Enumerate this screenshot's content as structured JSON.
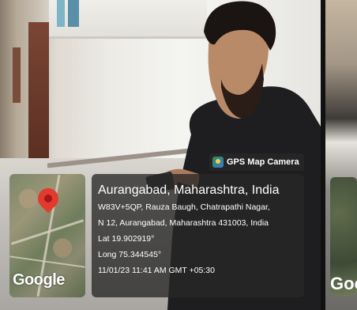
{
  "overlay": {
    "app_name": "GPS Map Camera",
    "app_icon": "gps-map-camera-icon"
  },
  "map": {
    "pin_icon": "map-pin-icon",
    "logo_text": "Google"
  },
  "location": {
    "title": "Aurangabad, Maharashtra, India",
    "address_line1": "W83V+5QP, Rauza Baugh, Chatrapathi Nagar,",
    "address_line2": "N 12, Aurangabad, Maharashtra 431003, India",
    "latitude": "Lat 19.902919°",
    "longitude": "Long 75.344545°",
    "timestamp": "11/01/23 11:41 AM GMT +05:30"
  },
  "second_photo": {
    "logo_fragment": "Goo"
  },
  "colors": {
    "overlay_bg": "#282828",
    "pin": "#e23b2e",
    "text": "#ffffff"
  }
}
